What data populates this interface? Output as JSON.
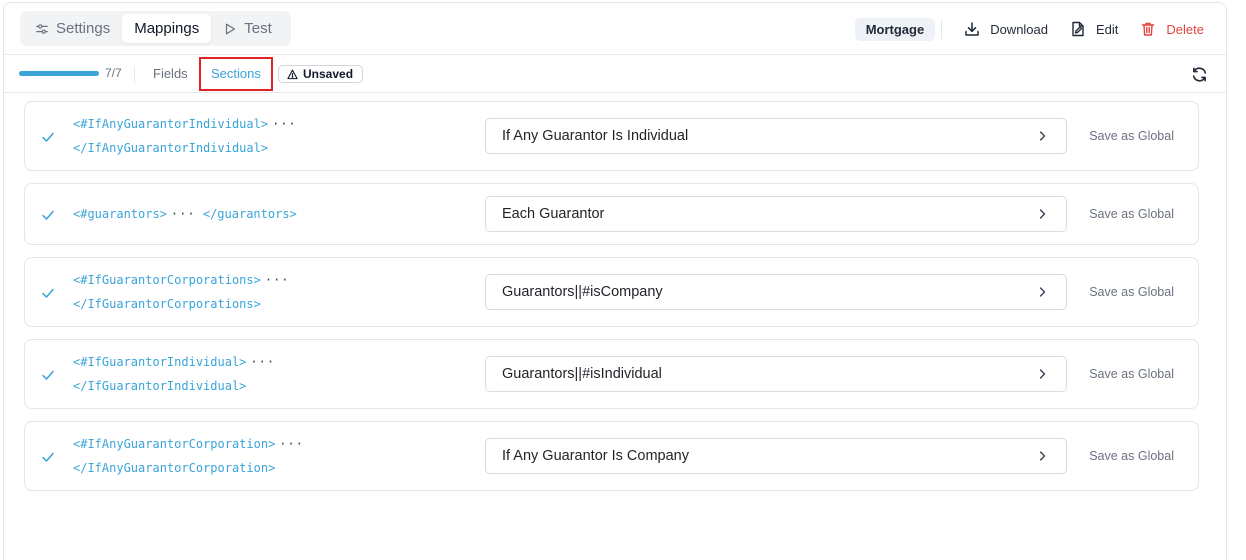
{
  "tabs": [
    {
      "label": "Settings",
      "icon": "sliders-icon",
      "active": false
    },
    {
      "label": "Mappings",
      "icon": "",
      "active": true
    },
    {
      "label": "Test",
      "icon": "play-icon",
      "active": false
    }
  ],
  "header": {
    "badge": "Mortgage",
    "download_label": "Download",
    "edit_label": "Edit",
    "delete_label": "Delete",
    "delete_color": "#e0463f"
  },
  "subbar": {
    "progress_text": "7/7",
    "progress_fraction": 1.0,
    "fields_label": "Fields",
    "sections_label": "Sections",
    "unsaved_label": "Unsaved",
    "accent_color": "#3aa4d9"
  },
  "rows": [
    {
      "code_open": "<#IfAnyGuarantorIndividual>",
      "dots": "···",
      "code_close": "</IfAnyGuarantorIndividual>",
      "value": "If Any Guarantor Is Individual",
      "action": "Save as Global"
    },
    {
      "code_open": "<#guarantors>",
      "dots": "···",
      "code_close": "</guarantors>",
      "value": "Each Guarantor",
      "action": "Save as Global"
    },
    {
      "code_open": "<#IfGuarantorCorporations>",
      "dots": "···",
      "code_close": "</IfGuarantorCorporations>",
      "value": "Guarantors||#isCompany",
      "action": "Save as Global"
    },
    {
      "code_open": "<#IfGuarantorIndividual>",
      "dots": "···",
      "code_close": "</IfGuarantorIndividual>",
      "value": "Guarantors||#isIndividual",
      "action": "Save as Global"
    },
    {
      "code_open": "<#IfAnyGuarantorCorporation>",
      "dots": "···",
      "code_close": "</IfAnyGuarantorCorporation>",
      "value": "If Any Guarantor Is Company",
      "action": "Save as Global"
    }
  ]
}
